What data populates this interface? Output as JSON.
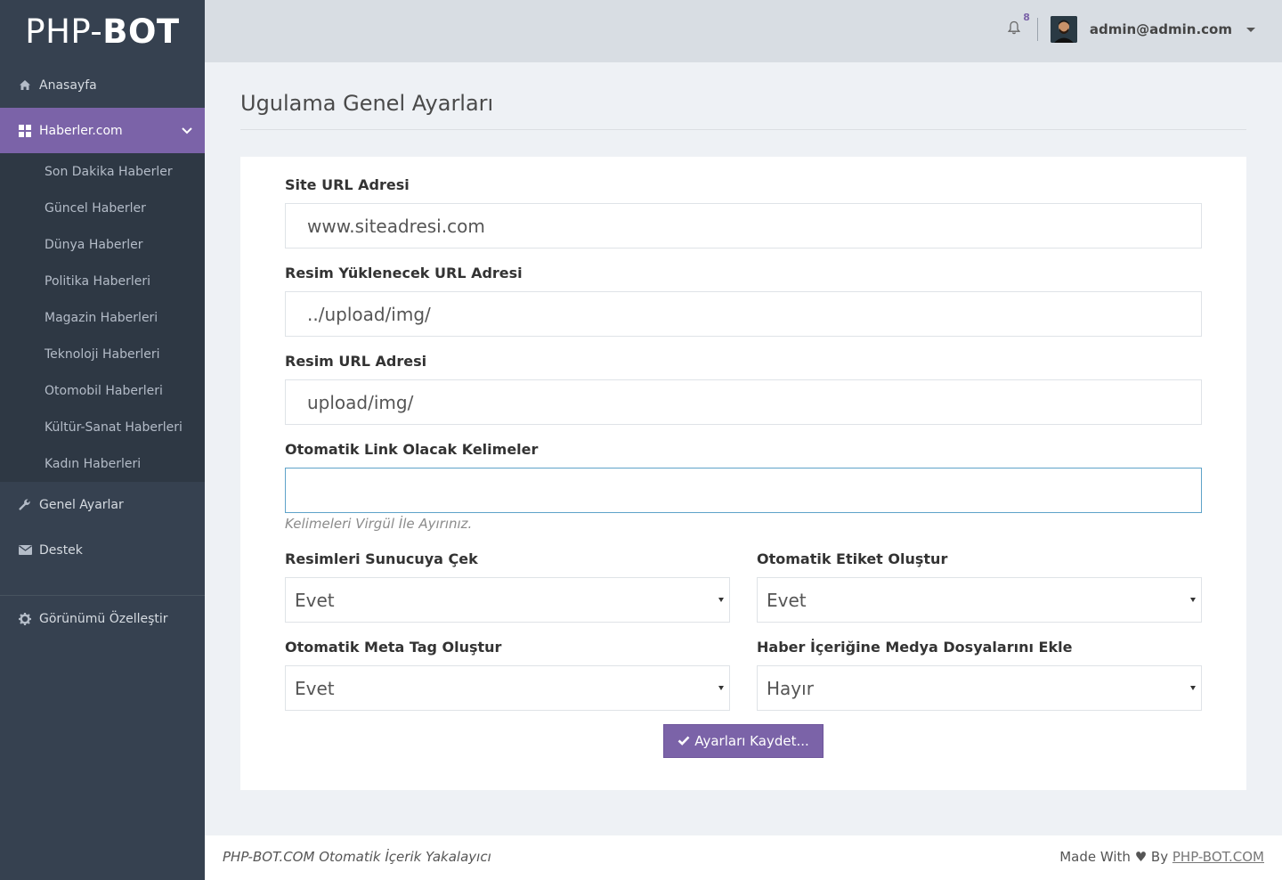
{
  "brand": {
    "prefix": "PHP-",
    "bold": "BOT"
  },
  "sidebar": {
    "items": [
      {
        "label": "Anasayfa",
        "icon": "home-icon"
      },
      {
        "label": "Haberler.com",
        "icon": "grid-icon"
      },
      {
        "label": "Genel Ayarlar",
        "icon": "wrench-icon"
      },
      {
        "label": "Destek",
        "icon": "envelope-icon"
      },
      {
        "label": "Görünümü Özelleştir",
        "icon": "gear-icon"
      }
    ],
    "subitems": [
      "Son Dakika Haberler",
      "Güncel Haberler",
      "Dünya Haberler",
      "Politika Haberleri",
      "Magazin Haberleri",
      "Teknoloji Haberleri",
      "Otomobil Haberleri",
      "Kültür-Sanat Haberleri",
      "Kadın Haberleri"
    ]
  },
  "header": {
    "notification_count": "8",
    "user_email": "admin@admin.com"
  },
  "page": {
    "title": "Ugulama Genel Ayarları"
  },
  "form": {
    "site_url": {
      "label": "Site URL Adresi",
      "value": "www.siteadresi.com"
    },
    "upload_url": {
      "label": "Resim Yüklenecek URL Adresi",
      "value": "../upload/img/"
    },
    "image_url": {
      "label": "Resim URL Adresi",
      "value": "upload/img/"
    },
    "auto_link": {
      "label": "Otomatik Link Olacak Kelimeler",
      "value": "",
      "help": "Kelimeleri Virgül İle Ayırınız."
    },
    "fetch_images": {
      "label": "Resimleri Sunucuya Çek",
      "value": "Evet"
    },
    "auto_tags": {
      "label": "Otomatik Etiket Oluştur",
      "value": "Evet"
    },
    "auto_meta": {
      "label": "Otomatik Meta Tag Oluştur",
      "value": "Evet"
    },
    "add_media": {
      "label": "Haber İçeriğine Medya Dosyalarını Ekle",
      "value": "Hayır"
    },
    "save_label": "Ayarları Kaydet..."
  },
  "footer": {
    "left": "PHP-BOT.COM Otomatik İçerik Yakalayıcı",
    "made_with": "Made With ♥ By",
    "link": "PHP-BOT.COM"
  },
  "colors": {
    "sidebar": "#364150",
    "accent": "#7b63a8",
    "header": "#d8dde3"
  }
}
